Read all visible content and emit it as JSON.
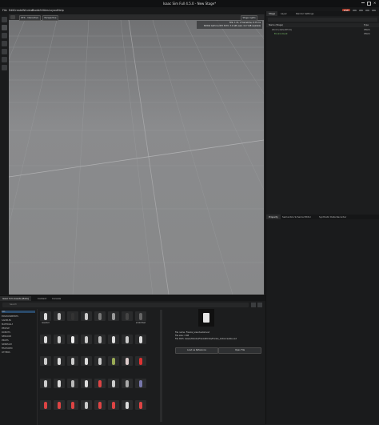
{
  "window": {
    "title": "Isaac Sim Full 4.5.0 - New Stage*"
  },
  "menu": [
    "File",
    "Edit",
    "Create",
    "Window",
    "Tools",
    "Utilities",
    "Layout",
    "Help"
  ],
  "toolbar_right": {
    "live_label": "LIVE"
  },
  "viewport": {
    "buttons": [
      "RTX - Interactive",
      "Perspective"
    ],
    "stage_lights": "Stage Lights",
    "stats": [
      "FPS: 7.74, 1 Frametime: 8.75 ms",
      "NVIDIA GeForce RTX 3070: 3.2 GiB used, 12.7 GiB available"
    ]
  },
  "stage_panel": {
    "tabs": [
      "Stage",
      "Layer",
      "Render Settings"
    ],
    "header": {
      "name": "Name (Stage)",
      "type": "Type"
    },
    "rows": [
      {
        "name": "World (defaultPrim)",
        "type": "Xform"
      },
      {
        "name": "Environment",
        "type": "Xform"
      }
    ]
  },
  "property_panel": {
    "tabs": [
      "Property",
      "Semantics Schema Editor",
      "Synthetic Data Recorder"
    ]
  },
  "bottom_panel": {
    "tabs": [
      "Isaac Sim Assets [Beta]",
      "Content",
      "Console"
    ],
    "search_placeholder": "Search",
    "tree": [
      "ALL",
      "ENVIRONMENTS",
      "SAMPLES",
      "MATERIALS",
      "PEOPLE",
      "ROBOTS",
      "SENSORS",
      "PROPS",
      "SIMREADY",
      "FEATURED",
      "OTHERS"
    ],
    "assets_row1_labels": [
      "Isaacbot",
      "",
      "",
      "",
      "",
      "",
      "",
      "",
      "",
      "scratchbed"
    ],
    "assets_row2_labels": [
      "",
      "",
      "",
      "",
      "",
      "",
      "",
      "",
      "",
      ""
    ],
    "assets_row3_labels": [
      "",
      "",
      "",
      "",
      "",
      "",
      "",
      "",
      "",
      ""
    ],
    "preview_info": {
      "name": "File name: Franka_Ivasotusdat.usd",
      "size": "File size: 4 KB",
      "path": "File Path: /Isaac/Robots/FrankaEmika/franka_instanceable.usd"
    },
    "buttons": [
      "Load as Reference",
      "Open File"
    ]
  },
  "colors": {
    "accent_live": "#a43a2a",
    "selection": "#2a4a6a",
    "highlight_green": "#7cc06a"
  }
}
